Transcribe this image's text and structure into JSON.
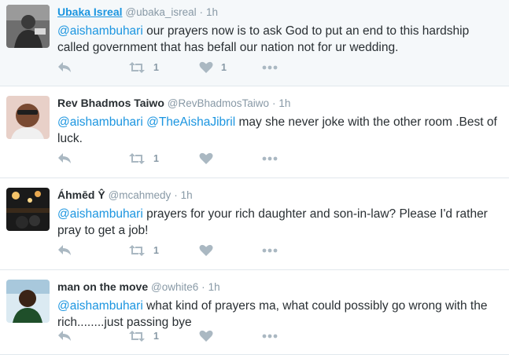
{
  "tweets": [
    {
      "display_name": "Ubaka Isreal",
      "handle": "@ubaka_isreal",
      "separator": "·",
      "time": "1h",
      "mentions": [
        "@aishambuhari"
      ],
      "text": "our prayers now is to ask God to put an end to this hardship called government that has befall our nation not for ur wedding.",
      "retweet_count": "1",
      "like_count": "1"
    },
    {
      "display_name": "Rev Bhadmos Taiwo",
      "handle": "@RevBhadmosTaiwo",
      "separator": "·",
      "time": "1h",
      "mentions": [
        "@aishambuhari",
        "@TheAishaJibril"
      ],
      "text": "may she never joke with the other room .Best of luck.",
      "retweet_count": "1",
      "like_count": ""
    },
    {
      "display_name": "Áhmēd Ŷ",
      "handle": "@mcahmedy",
      "separator": "·",
      "time": "1h",
      "mentions": [
        "@aishambuhari"
      ],
      "text": "prayers for your rich daughter and son-in-law? Please I'd rather pray to get a job!",
      "retweet_count": "1",
      "like_count": ""
    },
    {
      "display_name": "man on the move",
      "handle": "@owhite6",
      "separator": "·",
      "time": "1h",
      "mentions": [
        "@aishambuhari"
      ],
      "text": "what kind of prayers ma, what could possibly go wrong with the rich........just passing bye",
      "retweet_count": "1",
      "like_count": ""
    }
  ],
  "icons": {
    "reply": "reply-icon",
    "retweet": "retweet-icon",
    "like": "heart-icon",
    "more": "more-icon"
  },
  "colors": {
    "link": "#1b95e0",
    "icon": "#aab8c2",
    "muted": "#8899a6",
    "highlight_bg": "#f5f8fa",
    "divider": "#e1e8ed"
  }
}
